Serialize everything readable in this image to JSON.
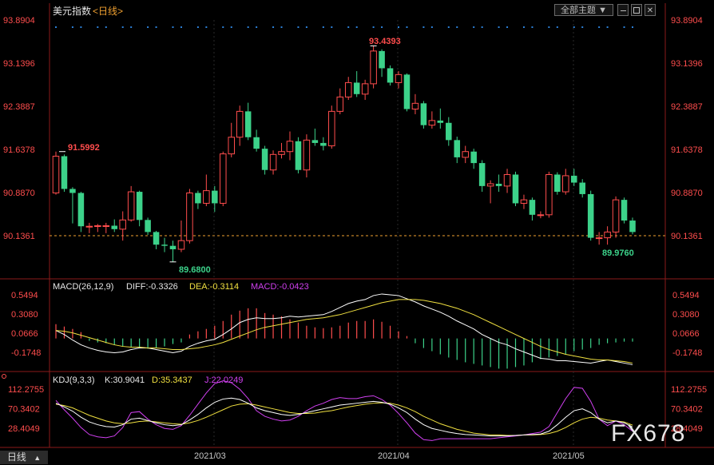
{
  "header": {
    "title": "美元指数",
    "period": "<日线>",
    "theme_button": "全部主题",
    "theme_arrow": "▼",
    "win_buttons": [
      "min-icon",
      "restore-icon",
      "close-icon"
    ]
  },
  "colors": {
    "up": "#ff4d4d",
    "down": "#3cd28a",
    "axis": "#ff4d4d",
    "last_line": "#f0a030",
    "dots": "#2b7fd6",
    "diff": "#ffffff",
    "dea": "#f0e040",
    "macd_label": "#d040f0",
    "k": "#ffffff",
    "d": "#f0e040",
    "j": "#d040f0"
  },
  "price_axis": [
    "93.8904",
    "93.1396",
    "92.3887",
    "91.6378",
    "90.8870",
    "90.1361"
  ],
  "annotations": {
    "high": "93.4393",
    "low1": "89.6800",
    "left_high": "91.5992",
    "low2": "89.9760"
  },
  "macd": {
    "title": "MACD(26,12,9)",
    "diff_label": "DIFF:-0.3326",
    "dea_label": "DEA:-0.3114",
    "macd_label": "MACD:-0.0423",
    "axis": [
      "0.5494",
      "0.3080",
      "0.0666",
      "-0.1748"
    ]
  },
  "kdj": {
    "title": "KDJ(9,3,3)",
    "k_label": "K:30.9041",
    "d_label": "D:35.3437",
    "j_label": "J:22.0249",
    "axis": [
      "112.2755",
      "70.3402",
      "28.4049"
    ]
  },
  "x_axis": [
    "2021/03",
    "2021/04",
    "2021/05"
  ],
  "bottom_tab": "日线",
  "bottom_tab_arrow": "▲",
  "watermark": "FX678",
  "chart_data": {
    "type": "candlestick",
    "title": "美元指数",
    "period": "日线",
    "last_price": 90.1361,
    "ylim": [
      89.5,
      94.0
    ],
    "candles": [
      {
        "o": 90.88,
        "c": 91.52,
        "h": 91.6,
        "l": 90.85
      },
      {
        "o": 91.52,
        "c": 90.95,
        "h": 91.55,
        "l": 90.9
      },
      {
        "o": 90.95,
        "c": 90.88,
        "h": 90.98,
        "l": 90.35
      },
      {
        "o": 90.88,
        "c": 90.3,
        "h": 90.9,
        "l": 90.2
      },
      {
        "o": 90.3,
        "c": 90.3,
        "h": 90.36,
        "l": 90.18
      },
      {
        "o": 90.3,
        "c": 90.31,
        "h": 90.34,
        "l": 90.2
      },
      {
        "o": 90.31,
        "c": 90.31,
        "h": 90.36,
        "l": 90.18
      },
      {
        "o": 90.31,
        "c": 90.25,
        "h": 90.42,
        "l": 90.2
      },
      {
        "o": 90.25,
        "c": 90.41,
        "h": 90.56,
        "l": 90.05
      },
      {
        "o": 90.41,
        "c": 90.9,
        "h": 91.0,
        "l": 90.38
      },
      {
        "o": 90.9,
        "c": 90.41,
        "h": 90.92,
        "l": 90.3
      },
      {
        "o": 90.41,
        "c": 90.2,
        "h": 90.45,
        "l": 90.15
      },
      {
        "o": 90.2,
        "c": 89.98,
        "h": 90.22,
        "l": 89.9
      },
      {
        "o": 89.98,
        "c": 89.96,
        "h": 90.1,
        "l": 89.85
      },
      {
        "o": 89.96,
        "c": 89.9,
        "h": 90.05,
        "l": 89.68
      },
      {
        "o": 89.9,
        "c": 90.05,
        "h": 90.4,
        "l": 89.85
      },
      {
        "o": 90.05,
        "c": 90.88,
        "h": 90.95,
        "l": 90.0
      },
      {
        "o": 90.88,
        "c": 90.7,
        "h": 90.92,
        "l": 90.6
      },
      {
        "o": 90.7,
        "c": 90.92,
        "h": 91.2,
        "l": 90.65
      },
      {
        "o": 90.92,
        "c": 90.7,
        "h": 91.0,
        "l": 90.55
      },
      {
        "o": 90.7,
        "c": 91.56,
        "h": 91.6,
        "l": 90.65
      },
      {
        "o": 91.56,
        "c": 91.85,
        "h": 92.1,
        "l": 91.5
      },
      {
        "o": 91.85,
        "c": 92.3,
        "h": 92.4,
        "l": 91.7
      },
      {
        "o": 92.3,
        "c": 91.85,
        "h": 92.45,
        "l": 91.8
      },
      {
        "o": 91.85,
        "c": 91.65,
        "h": 91.98,
        "l": 91.6
      },
      {
        "o": 91.65,
        "c": 91.28,
        "h": 91.7,
        "l": 91.2
      },
      {
        "o": 91.28,
        "c": 91.55,
        "h": 91.62,
        "l": 91.2
      },
      {
        "o": 91.55,
        "c": 91.6,
        "h": 91.75,
        "l": 91.48
      },
      {
        "o": 91.6,
        "c": 91.78,
        "h": 91.95,
        "l": 91.45
      },
      {
        "o": 91.78,
        "c": 91.28,
        "h": 91.85,
        "l": 91.22
      },
      {
        "o": 91.28,
        "c": 91.8,
        "h": 91.9,
        "l": 91.15
      },
      {
        "o": 91.8,
        "c": 91.75,
        "h": 92.0,
        "l": 91.7
      },
      {
        "o": 91.75,
        "c": 91.7,
        "h": 91.85,
        "l": 91.62
      },
      {
        "o": 91.7,
        "c": 92.3,
        "h": 92.4,
        "l": 91.65
      },
      {
        "o": 92.3,
        "c": 92.55,
        "h": 92.7,
        "l": 92.25
      },
      {
        "o": 92.55,
        "c": 92.8,
        "h": 92.9,
        "l": 92.5
      },
      {
        "o": 92.8,
        "c": 92.6,
        "h": 93.0,
        "l": 92.55
      },
      {
        "o": 92.6,
        "c": 92.78,
        "h": 92.85,
        "l": 92.5
      },
      {
        "o": 92.78,
        "c": 93.35,
        "h": 93.44,
        "l": 92.7
      },
      {
        "o": 93.35,
        "c": 93.05,
        "h": 93.38,
        "l": 92.9
      },
      {
        "o": 93.05,
        "c": 92.8,
        "h": 93.1,
        "l": 92.75
      },
      {
        "o": 92.8,
        "c": 92.94,
        "h": 93.0,
        "l": 92.7
      },
      {
        "o": 92.94,
        "c": 92.34,
        "h": 92.96,
        "l": 92.3
      },
      {
        "o": 92.34,
        "c": 92.44,
        "h": 92.6,
        "l": 92.25
      },
      {
        "o": 92.44,
        "c": 92.06,
        "h": 92.48,
        "l": 92.0
      },
      {
        "o": 92.06,
        "c": 92.14,
        "h": 92.3,
        "l": 92.0
      },
      {
        "o": 92.14,
        "c": 92.1,
        "h": 92.35,
        "l": 92.0
      },
      {
        "o": 92.1,
        "c": 91.8,
        "h": 92.2,
        "l": 91.7
      },
      {
        "o": 91.8,
        "c": 91.5,
        "h": 91.86,
        "l": 91.4
      },
      {
        "o": 91.5,
        "c": 91.6,
        "h": 91.7,
        "l": 91.4
      },
      {
        "o": 91.6,
        "c": 91.4,
        "h": 91.65,
        "l": 91.3
      },
      {
        "o": 91.4,
        "c": 91.0,
        "h": 91.45,
        "l": 90.9
      },
      {
        "o": 91.0,
        "c": 91.04,
        "h": 91.1,
        "l": 90.7
      },
      {
        "o": 91.04,
        "c": 91.0,
        "h": 91.2,
        "l": 90.9
      },
      {
        "o": 91.0,
        "c": 91.2,
        "h": 91.3,
        "l": 90.88
      },
      {
        "o": 91.2,
        "c": 90.7,
        "h": 91.25,
        "l": 90.65
      },
      {
        "o": 90.7,
        "c": 90.76,
        "h": 90.85,
        "l": 90.6
      },
      {
        "o": 90.76,
        "c": 90.5,
        "h": 90.8,
        "l": 90.4
      },
      {
        "o": 90.5,
        "c": 90.5,
        "h": 90.56,
        "l": 90.44
      },
      {
        "o": 90.5,
        "c": 91.2,
        "h": 91.25,
        "l": 90.45
      },
      {
        "o": 91.2,
        "c": 90.9,
        "h": 91.24,
        "l": 90.85
      },
      {
        "o": 90.9,
        "c": 91.18,
        "h": 91.3,
        "l": 90.85
      },
      {
        "o": 91.18,
        "c": 91.06,
        "h": 91.3,
        "l": 91.0
      },
      {
        "o": 91.06,
        "c": 90.86,
        "h": 91.12,
        "l": 90.8
      },
      {
        "o": 90.86,
        "c": 90.1,
        "h": 90.92,
        "l": 90.05
      },
      {
        "o": 90.1,
        "c": 90.1,
        "h": 90.2,
        "l": 89.98
      },
      {
        "o": 90.1,
        "c": 90.2,
        "h": 90.3,
        "l": 89.98
      },
      {
        "o": 90.2,
        "c": 90.76,
        "h": 90.82,
        "l": 90.1
      },
      {
        "o": 90.76,
        "c": 90.4,
        "h": 90.8,
        "l": 90.35
      },
      {
        "o": 90.4,
        "c": 90.2,
        "h": 90.45,
        "l": 90.16
      }
    ],
    "macd_series": {
      "diff": [
        0.1,
        0.05,
        -0.02,
        -0.08,
        -0.12,
        -0.15,
        -0.17,
        -0.18,
        -0.17,
        -0.14,
        -0.12,
        -0.12,
        -0.14,
        -0.16,
        -0.18,
        -0.16,
        -0.1,
        -0.06,
        -0.03,
        -0.01,
        0.05,
        0.12,
        0.2,
        0.24,
        0.26,
        0.25,
        0.25,
        0.26,
        0.28,
        0.27,
        0.28,
        0.29,
        0.3,
        0.34,
        0.39,
        0.44,
        0.47,
        0.49,
        0.54,
        0.56,
        0.55,
        0.54,
        0.5,
        0.46,
        0.41,
        0.37,
        0.33,
        0.28,
        0.22,
        0.17,
        0.12,
        0.05,
        0.0,
        -0.05,
        -0.08,
        -0.13,
        -0.17,
        -0.21,
        -0.25,
        -0.26,
        -0.28,
        -0.28,
        -0.29,
        -0.3,
        -0.31,
        -0.29,
        -0.27,
        -0.29,
        -0.31,
        -0.33
      ],
      "dea": [
        0.1,
        0.09,
        0.07,
        0.04,
        0.01,
        -0.02,
        -0.05,
        -0.08,
        -0.1,
        -0.11,
        -0.11,
        -0.12,
        -0.12,
        -0.13,
        -0.14,
        -0.14,
        -0.13,
        -0.12,
        -0.1,
        -0.08,
        -0.05,
        -0.01,
        0.03,
        0.07,
        0.11,
        0.14,
        0.16,
        0.18,
        0.2,
        0.22,
        0.24,
        0.25,
        0.26,
        0.28,
        0.3,
        0.33,
        0.36,
        0.39,
        0.42,
        0.45,
        0.47,
        0.49,
        0.49,
        0.49,
        0.48,
        0.46,
        0.44,
        0.41,
        0.38,
        0.34,
        0.3,
        0.25,
        0.2,
        0.15,
        0.1,
        0.05,
        0.0,
        -0.05,
        -0.1,
        -0.14,
        -0.17,
        -0.2,
        -0.22,
        -0.24,
        -0.26,
        -0.27,
        -0.27,
        -0.28,
        -0.29,
        -0.31
      ],
      "macd": [
        0.18,
        0.15,
        0.12,
        0.08,
        -0.03,
        -0.05,
        -0.06,
        -0.08,
        -0.1,
        -0.11,
        -0.12,
        -0.13,
        -0.12,
        -0.1,
        -0.07,
        -0.05,
        0.05,
        0.09,
        0.12,
        0.16,
        0.22,
        0.3,
        0.35,
        0.38,
        0.38,
        0.32,
        0.3,
        0.28,
        0.24,
        0.2,
        0.16,
        0.14,
        0.13,
        0.14,
        0.16,
        0.2,
        0.22,
        0.22,
        0.24,
        0.21,
        0.16,
        0.09,
        0.03,
        -0.06,
        -0.12,
        -0.16,
        -0.2,
        -0.24,
        -0.27,
        -0.3,
        -0.32,
        -0.34,
        -0.36,
        -0.38,
        -0.38,
        -0.36,
        -0.34,
        -0.3,
        -0.26,
        -0.24,
        -0.22,
        -0.2,
        -0.16,
        -0.14,
        -0.12,
        -0.08,
        -0.06,
        -0.05,
        -0.04,
        -0.04
      ]
    },
    "kdj_series": {
      "k": [
        82,
        74,
        65,
        52,
        42,
        36,
        32,
        31,
        36,
        48,
        50,
        45,
        40,
        36,
        34,
        36,
        46,
        58,
        72,
        84,
        91,
        93,
        90,
        82,
        72,
        66,
        62,
        58,
        56,
        58,
        62,
        66,
        70,
        74,
        78,
        80,
        82,
        84,
        86,
        84,
        80,
        72,
        62,
        48,
        36,
        28,
        24,
        20,
        17,
        15,
        14,
        13,
        12,
        12,
        12,
        13,
        14,
        15,
        16,
        22,
        36,
        52,
        66,
        70,
        62,
        48,
        40,
        44,
        40,
        31
      ],
      "d": [
        80,
        77,
        72,
        64,
        56,
        50,
        44,
        40,
        38,
        40,
        43,
        44,
        42,
        40,
        38,
        37,
        40,
        45,
        52,
        60,
        68,
        76,
        80,
        81,
        78,
        74,
        70,
        66,
        62,
        60,
        60,
        61,
        64,
        66,
        70,
        74,
        77,
        80,
        82,
        83,
        82,
        78,
        72,
        64,
        54,
        46,
        38,
        32,
        26,
        22,
        18,
        16,
        14,
        14,
        13,
        13,
        14,
        14,
        15,
        17,
        22,
        30,
        40,
        48,
        52,
        50,
        46,
        44,
        42,
        35
      ],
      "j": [
        88,
        68,
        50,
        30,
        15,
        10,
        8,
        12,
        30,
        62,
        64,
        48,
        36,
        28,
        26,
        34,
        56,
        80,
        104,
        124,
        130,
        126,
        112,
        92,
        66,
        54,
        48,
        44,
        46,
        54,
        66,
        76,
        82,
        90,
        94,
        92,
        92,
        96,
        98,
        90,
        78,
        60,
        40,
        18,
        4,
        2,
        6,
        6,
        6,
        6,
        6,
        6,
        6,
        8,
        10,
        12,
        14,
        17,
        20,
        32,
        62,
        92,
        116,
        114,
        86,
        48,
        34,
        44,
        36,
        22
      ]
    }
  }
}
